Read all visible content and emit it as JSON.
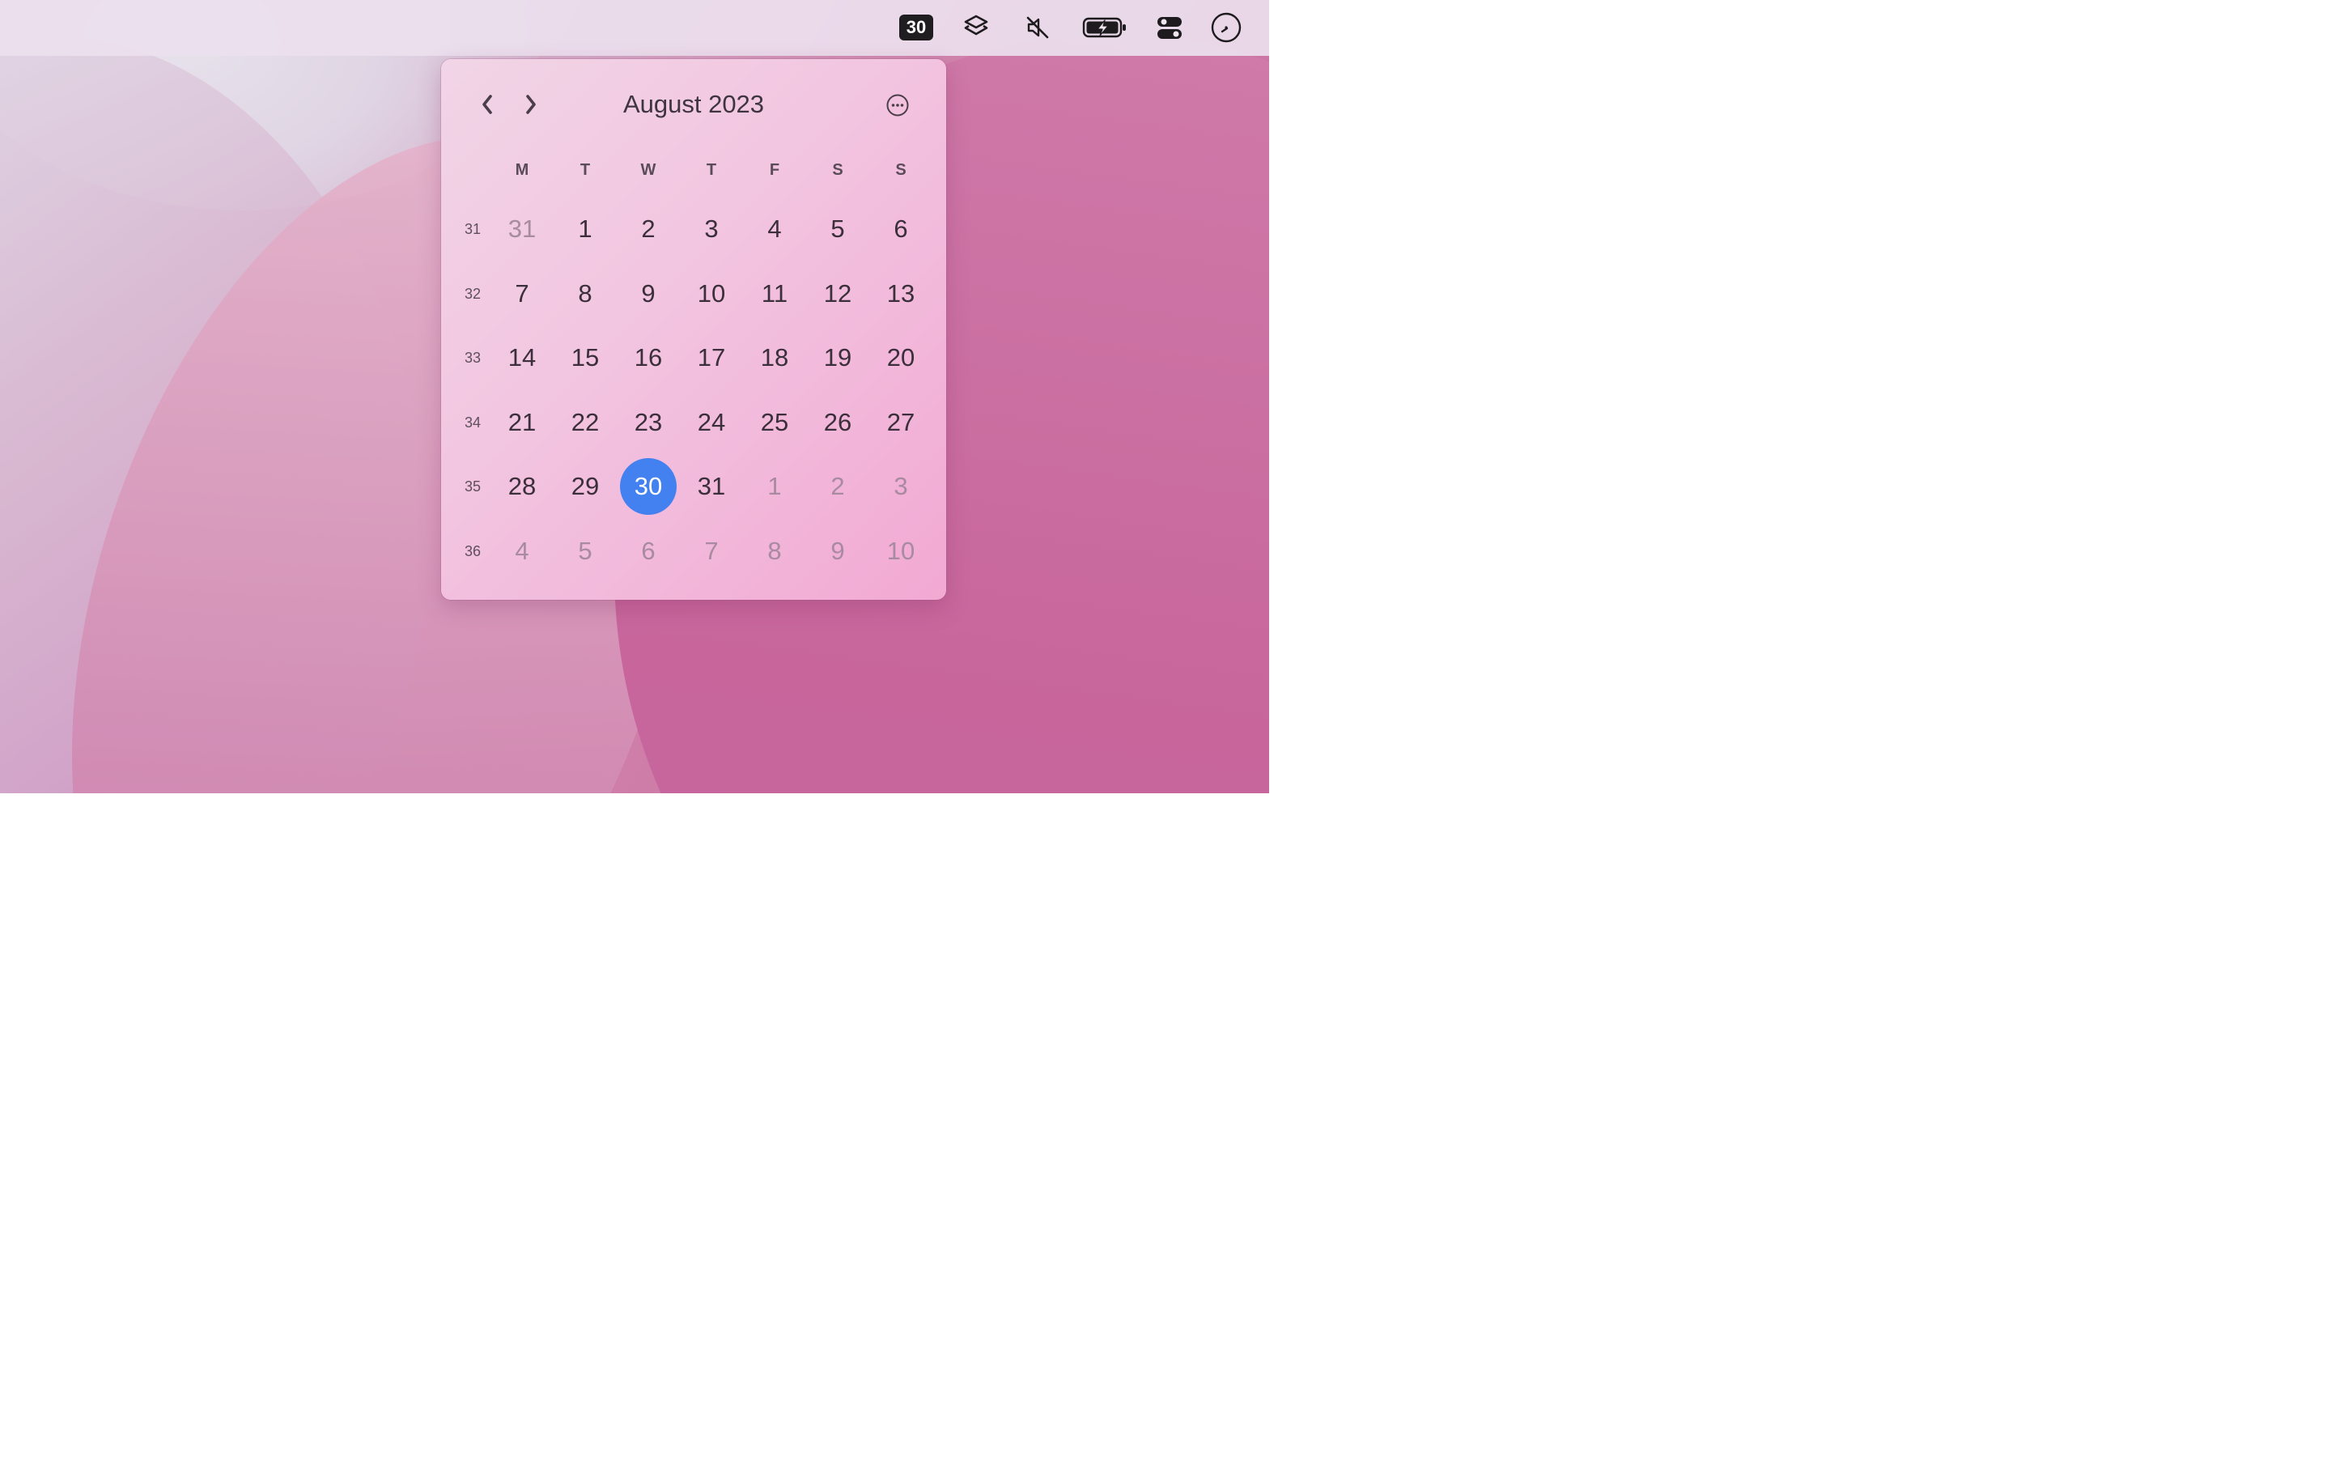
{
  "menubar": {
    "date_badge": "30",
    "icons": [
      "layers-icon",
      "mute-icon",
      "battery-charging-icon",
      "toggles-icon",
      "clock-icon"
    ]
  },
  "calendar": {
    "title": "August 2023",
    "prev_symbol": "‹",
    "next_symbol": "›",
    "weekdays": [
      "M",
      "T",
      "W",
      "T",
      "F",
      "S",
      "S"
    ],
    "today_color": "#4281ef",
    "weeks": [
      {
        "number": "31",
        "days": [
          {
            "d": "31",
            "muted": true
          },
          {
            "d": "1"
          },
          {
            "d": "2"
          },
          {
            "d": "3"
          },
          {
            "d": "4"
          },
          {
            "d": "5"
          },
          {
            "d": "6"
          }
        ]
      },
      {
        "number": "32",
        "days": [
          {
            "d": "7"
          },
          {
            "d": "8"
          },
          {
            "d": "9"
          },
          {
            "d": "10"
          },
          {
            "d": "11"
          },
          {
            "d": "12"
          },
          {
            "d": "13"
          }
        ]
      },
      {
        "number": "33",
        "days": [
          {
            "d": "14"
          },
          {
            "d": "15"
          },
          {
            "d": "16"
          },
          {
            "d": "17"
          },
          {
            "d": "18"
          },
          {
            "d": "19"
          },
          {
            "d": "20"
          }
        ]
      },
      {
        "number": "34",
        "days": [
          {
            "d": "21"
          },
          {
            "d": "22"
          },
          {
            "d": "23"
          },
          {
            "d": "24"
          },
          {
            "d": "25"
          },
          {
            "d": "26"
          },
          {
            "d": "27"
          }
        ]
      },
      {
        "number": "35",
        "days": [
          {
            "d": "28"
          },
          {
            "d": "29"
          },
          {
            "d": "30",
            "today": true
          },
          {
            "d": "31"
          },
          {
            "d": "1",
            "muted": true
          },
          {
            "d": "2",
            "muted": true
          },
          {
            "d": "3",
            "muted": true
          }
        ]
      },
      {
        "number": "36",
        "days": [
          {
            "d": "4",
            "muted": true
          },
          {
            "d": "5",
            "muted": true
          },
          {
            "d": "6",
            "muted": true
          },
          {
            "d": "7",
            "muted": true
          },
          {
            "d": "8",
            "muted": true
          },
          {
            "d": "9",
            "muted": true
          },
          {
            "d": "10",
            "muted": true
          }
        ]
      }
    ]
  }
}
